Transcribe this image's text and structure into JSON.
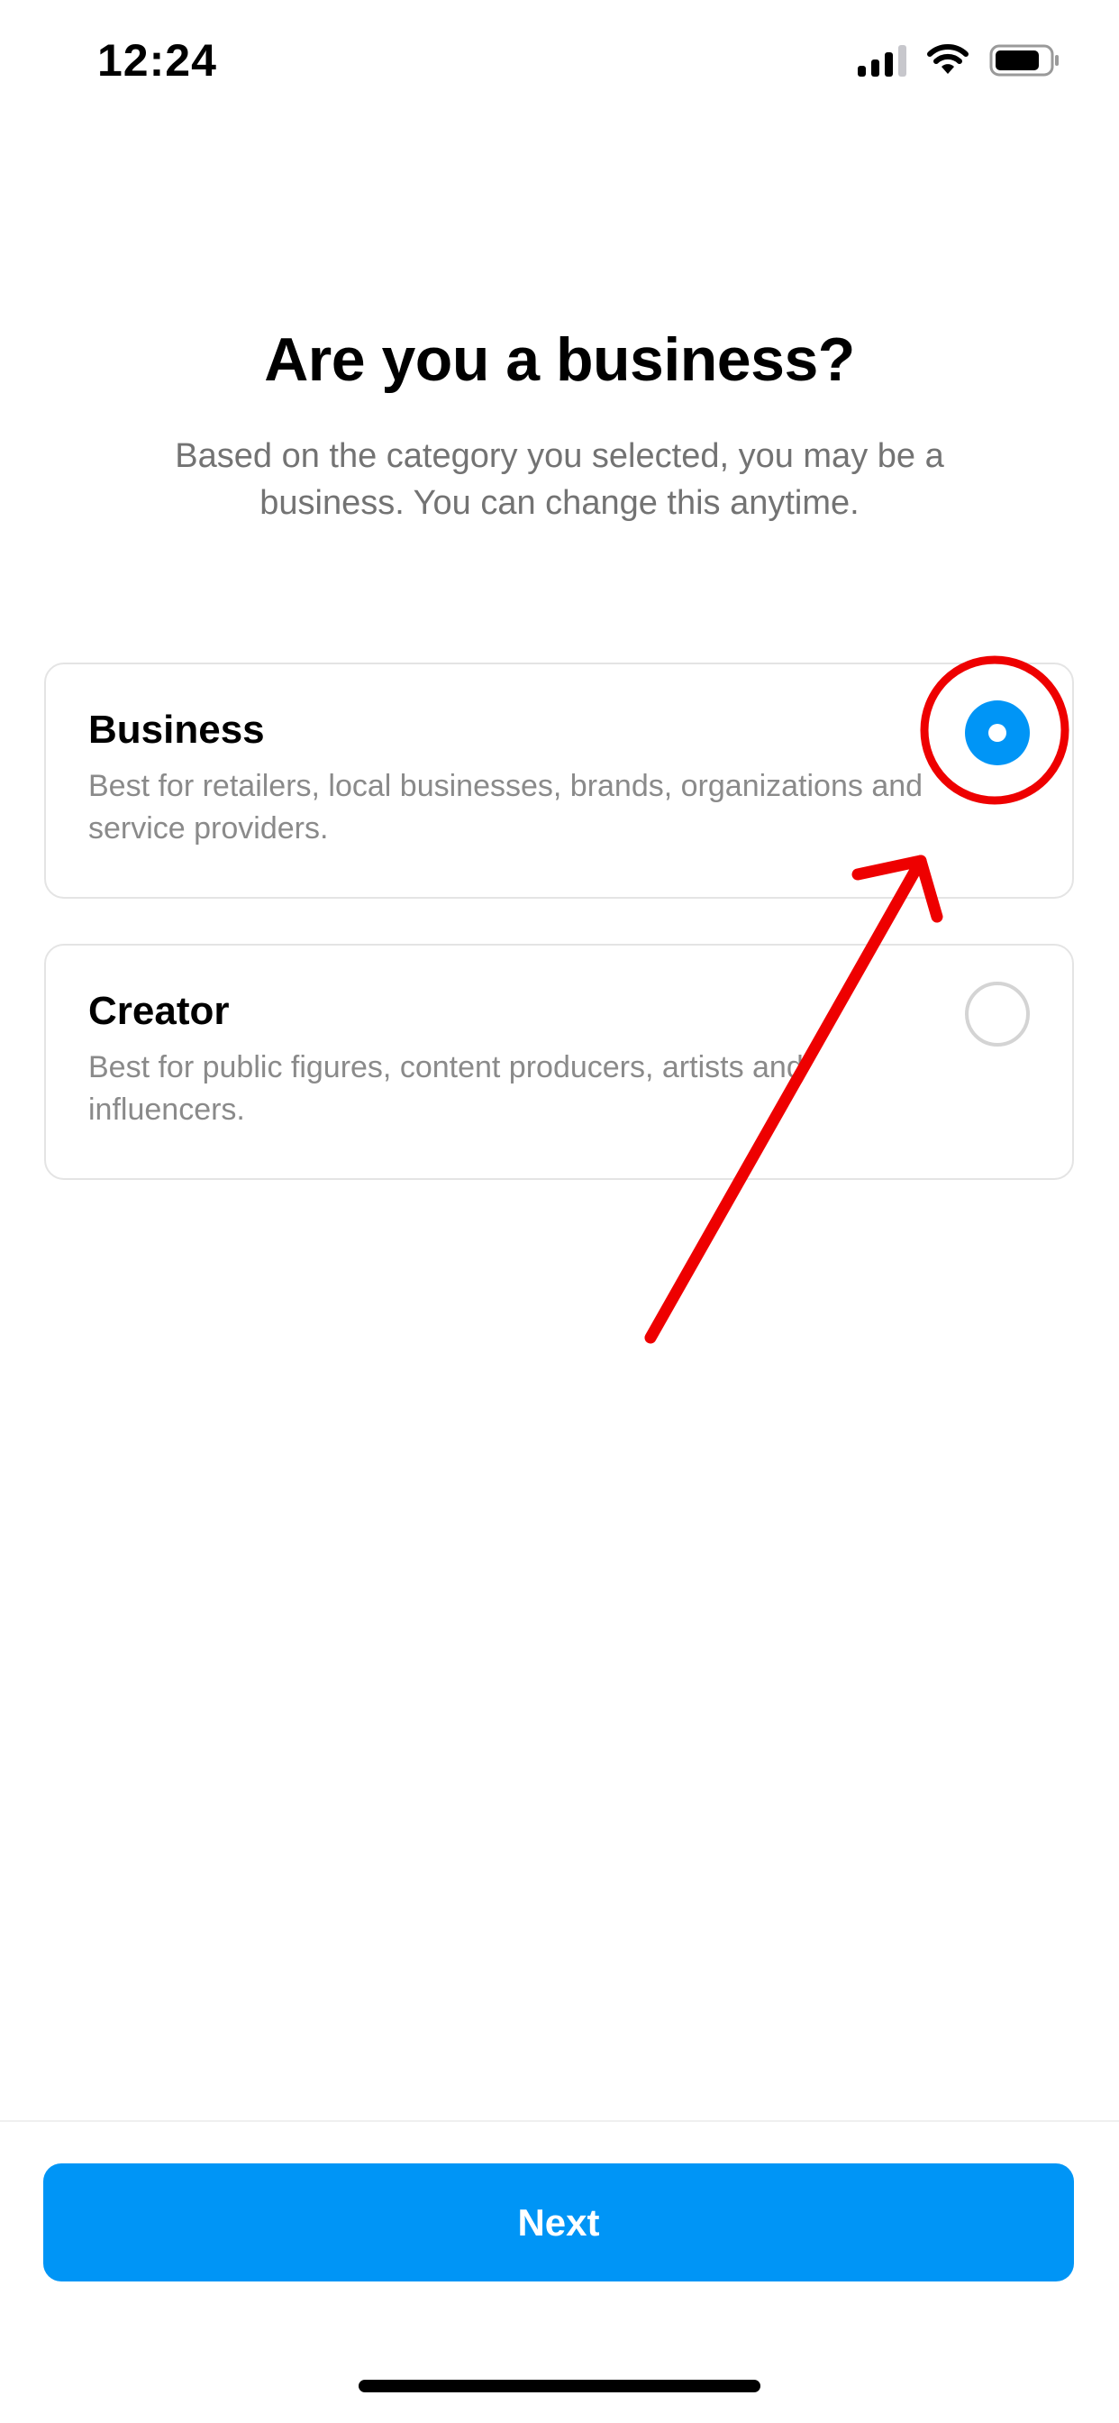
{
  "status_bar": {
    "time": "12:24",
    "icons": [
      "signal-icon",
      "wifi-icon",
      "battery-icon"
    ]
  },
  "header": {
    "title": "Are you a business?",
    "subtitle": "Based on the category you selected, you may be a business. You can change this anytime."
  },
  "options": [
    {
      "title": "Business",
      "description": "Best for retailers, local businesses, brands, organizations and service providers.",
      "selected": true
    },
    {
      "title": "Creator",
      "description": "Best for public figures, content producers, artists and influencers.",
      "selected": false
    }
  ],
  "footer": {
    "next_label": "Next"
  },
  "annotation": {
    "color": "#ee0000",
    "shapes": [
      "circle-annotation",
      "arrow-annotation"
    ]
  },
  "colors": {
    "accent": "#0095f6",
    "annotation": "#ee0000"
  }
}
